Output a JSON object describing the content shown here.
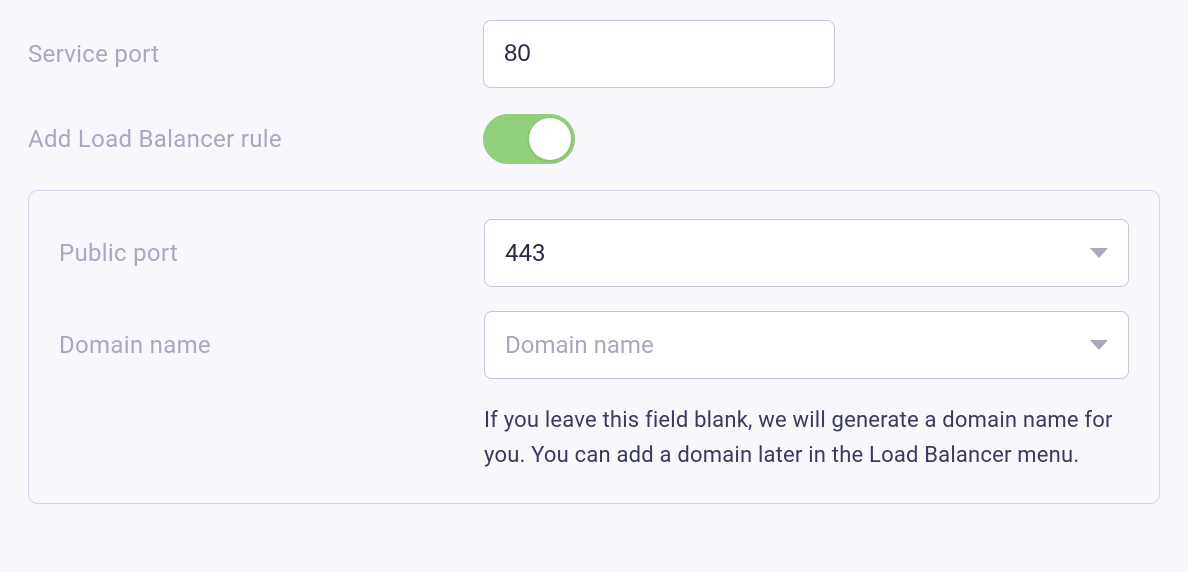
{
  "servicePort": {
    "label": "Service port",
    "value": "80"
  },
  "addLoadBalancerRule": {
    "label": "Add Load Balancer rule",
    "enabled": true
  },
  "publicPort": {
    "label": "Public port",
    "value": "443"
  },
  "domainName": {
    "label": "Domain name",
    "placeholder": "Domain name",
    "helper": "If you leave this field blank, we will generate a domain name for you. You can add a domain later in the Load Balancer menu."
  }
}
